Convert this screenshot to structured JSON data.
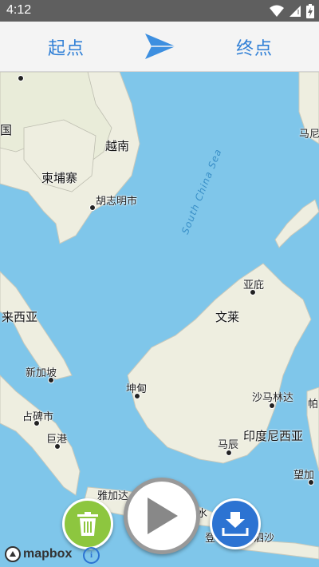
{
  "status_bar": {
    "time": "4:12"
  },
  "route_bar": {
    "start_label": "起点",
    "end_label": "终点"
  },
  "map": {
    "sea_label": "South China Sea",
    "places": [
      {
        "name": "越南"
      },
      {
        "name": "柬埔寨"
      },
      {
        "name": "胡志明市"
      },
      {
        "name": "马尼"
      },
      {
        "name": "亚庇"
      },
      {
        "name": "文莱"
      },
      {
        "name": "来西亚"
      },
      {
        "name": "新加坡"
      },
      {
        "name": "坤甸"
      },
      {
        "name": "沙马林达"
      },
      {
        "name": "占碑市"
      },
      {
        "name": "巨港"
      },
      {
        "name": "印度尼西亚"
      },
      {
        "name": "马辰"
      },
      {
        "name": "帕"
      },
      {
        "name": "望加"
      },
      {
        "name": "雅加达"
      },
      {
        "name": "水"
      },
      {
        "name": "登"
      },
      {
        "name": "泗沙"
      },
      {
        "name": "国"
      }
    ]
  },
  "attribution": {
    "brand": "mapbox",
    "info_symbol": "i"
  },
  "icons": {
    "arrow": "send-arrow-icon",
    "trash": "trash-icon",
    "play": "play-icon",
    "download": "download-icon"
  },
  "colors": {
    "accent": "#2f7fd6",
    "trash_button": "#8dc63f",
    "download_button": "#2c73d2",
    "water": "#7fc6ea",
    "land": "#eeeee0"
  }
}
